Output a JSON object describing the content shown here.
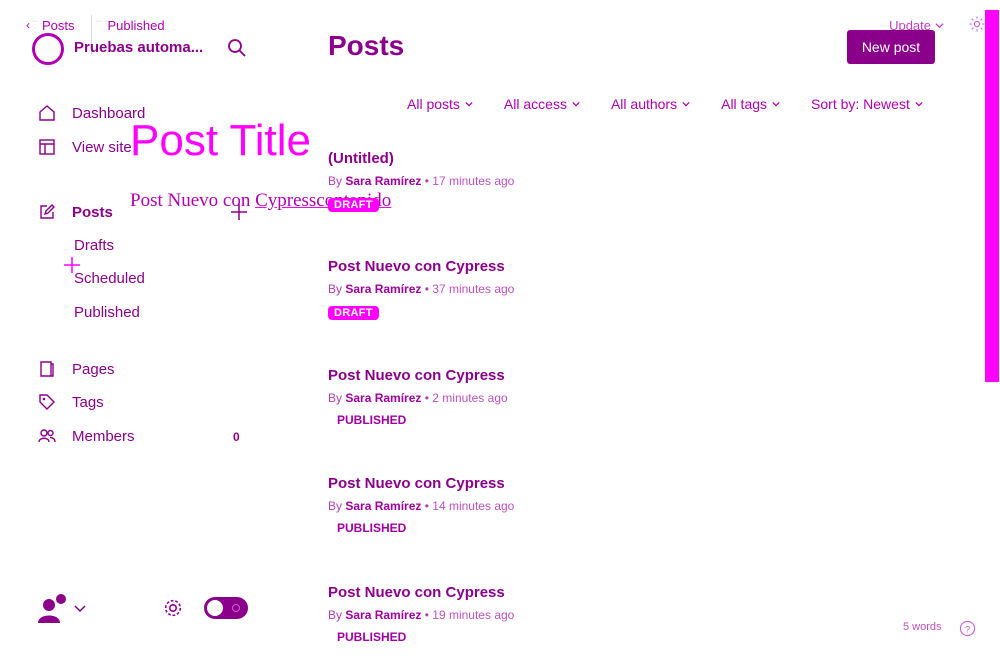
{
  "breadcrumb": {
    "back": "Posts",
    "status": "Published"
  },
  "header": {
    "update": "Update"
  },
  "site": {
    "name": "Pruebas automa..."
  },
  "nav": {
    "dashboard": "Dashboard",
    "view_site": "View site",
    "posts": "Posts",
    "drafts": "Drafts",
    "scheduled": "Scheduled",
    "published": "Published",
    "pages": "Pages",
    "tags": "Tags",
    "members": "Members",
    "members_count": "0"
  },
  "overlay": {
    "title": "Post Title",
    "body_start": "Post Nuevo con ",
    "body_underlined": "Cypresscontenido"
  },
  "main": {
    "title": "Posts",
    "new_post": "New post",
    "filters": [
      "All posts",
      "All access",
      "All authors",
      "All tags",
      "Sort by: Newest"
    ]
  },
  "posts": [
    {
      "title": "(Untitled)",
      "by": "By",
      "author": "Sara Ramírez",
      "ago": "17 minutes ago",
      "status": "DRAFT"
    },
    {
      "title": "Post Nuevo con Cypress",
      "by": "By",
      "author": "Sara Ramírez",
      "ago": "37 minutes ago",
      "status": "DRAFT"
    },
    {
      "title": "Post Nuevo con Cypress",
      "by": "By",
      "author": "Sara Ramírez",
      "ago": "2 minutes ago",
      "status": "PUBLISHED"
    },
    {
      "title": "Post Nuevo con Cypress",
      "by": "By",
      "author": "Sara Ramírez",
      "ago": "14 minutes ago",
      "status": "PUBLISHED"
    },
    {
      "title": "Post Nuevo con Cypress",
      "by": "By",
      "author": "Sara Ramírez",
      "ago": "19 minutes ago",
      "status": "PUBLISHED"
    }
  ],
  "editor": {
    "word_count": "5 words"
  },
  "icons": [
    "back-chevron-icon",
    "search-icon",
    "home-icon",
    "layout-icon",
    "edit-icon",
    "book-icon",
    "tag-icon",
    "members-icon",
    "gear-icon",
    "help-icon",
    "plus-icon",
    "chevron-down-icon"
  ],
  "colors": {
    "accent": "#8b008b",
    "highlight": "#ff00ff",
    "button_text": "#ffffff"
  }
}
